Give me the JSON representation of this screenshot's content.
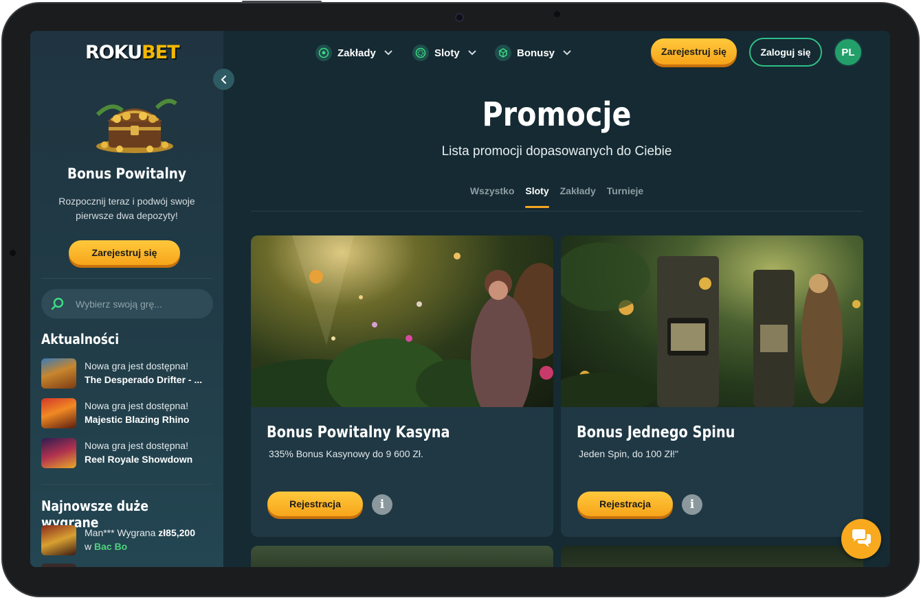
{
  "app": {
    "logo_part1": "ROKU",
    "logo_part2": "BET",
    "language": "PL"
  },
  "colors": {
    "accent": "#f7a51a",
    "brand_green": "#2fbf85",
    "background": "#152a32",
    "sidebar": "#1f3440",
    "card": "#1f3844"
  },
  "nav": {
    "items": [
      {
        "label": "Zakłady",
        "icon": "football-icon"
      },
      {
        "label": "Sloty",
        "icon": "chip-icon"
      },
      {
        "label": "Bonusy",
        "icon": "gift-icon"
      }
    ],
    "register_label": "Zarejestruj się",
    "login_label": "Zaloguj się"
  },
  "sidebar": {
    "bonus_title": "Bonus Powitalny",
    "bonus_desc": "Rozpocznij teraz i podwój swoje pierwsze dwa depozyty!",
    "register_label": "Zarejestruj się",
    "search_placeholder": "Wybierz swoją grę...",
    "news_title": "Aktualności",
    "news": [
      {
        "line1": "Nowa gra jest dostępna!",
        "line2": "The Desperado Drifter - ..."
      },
      {
        "line1": "Nowa gra jest dostępna!",
        "line2": "Majestic Blazing Rhino"
      },
      {
        "line1": "Nowa gra jest dostępna!",
        "line2": "Reel Royale Showdown"
      }
    ],
    "wins_title": "Najnowsze duże wygrane",
    "wins": [
      {
        "user_text": "Man*** Wygrana ",
        "amount": "zł85,200",
        "prefix": "w ",
        "game": "Bac Bo"
      }
    ]
  },
  "main": {
    "title": "Promocje",
    "subtitle": "Lista promocji dopasowanych do Ciebie",
    "tabs": [
      "Wszystko",
      "Sloty",
      "Zakłady",
      "Turnieje"
    ],
    "active_tab": "Sloty",
    "cards": [
      {
        "title": "Bonus Powitalny Kasyna",
        "desc": "335% Bonus Kasynowy do 9 600 Zł.",
        "button": "Rejestracja",
        "info": "i"
      },
      {
        "title": "Bonus Jednego Spinu",
        "desc": "Jeden Spin, do 100 Zł!\"",
        "button": "Rejestracja",
        "info": "i"
      }
    ]
  }
}
